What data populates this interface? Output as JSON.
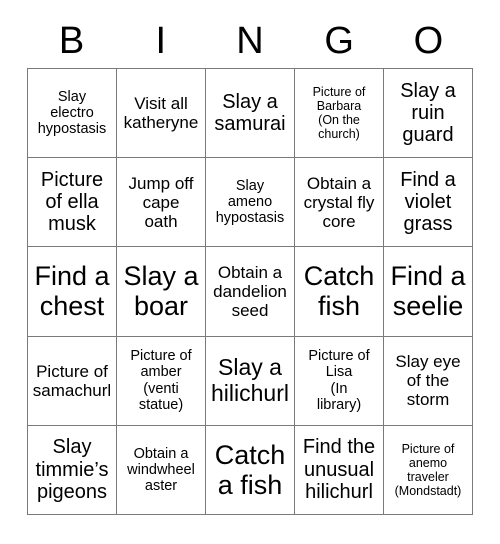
{
  "header": {
    "letters": [
      "B",
      "I",
      "N",
      "G",
      "O"
    ]
  },
  "grid": {
    "rows": 5,
    "columns": 5,
    "border_color": "#7a7a7a",
    "background_color": "#ffffff",
    "text_color": "#000000",
    "cells": [
      {
        "text": "Slay\nelectro\nhypostasis",
        "size": "s"
      },
      {
        "text": "Visit all\nkatheryne",
        "size": "m"
      },
      {
        "text": "Slay a\nsamurai",
        "size": "l"
      },
      {
        "text": "Picture of\nBarbara\n(On the\nchurch)",
        "size": "xs"
      },
      {
        "text": "Slay a\nruin\nguard",
        "size": "l"
      },
      {
        "text": "Picture\nof ella\nmusk",
        "size": "l"
      },
      {
        "text": "Jump off\ncape\noath",
        "size": "m"
      },
      {
        "text": "Slay\nameno\nhypostasis",
        "size": "s"
      },
      {
        "text": "Obtain a\ncrystal fly\ncore",
        "size": "m"
      },
      {
        "text": "Find a\nviolet\ngrass",
        "size": "l"
      },
      {
        "text": "Find a\nchest",
        "size": "xxl"
      },
      {
        "text": "Slay a\nboar",
        "size": "xxl"
      },
      {
        "text": "Obtain a\ndandelion\nseed",
        "size": "m"
      },
      {
        "text": "Catch\nfish",
        "size": "xxl"
      },
      {
        "text": "Find a\nseelie",
        "size": "xxl"
      },
      {
        "text": "Picture of\nsamachurl",
        "size": "m"
      },
      {
        "text": "Picture of\namber\n(venti\nstatue)",
        "size": "s"
      },
      {
        "text": "Slay a\nhilichurl",
        "size": "xl"
      },
      {
        "text": "Picture of\nLisa\n(In\nlibrary)",
        "size": "s"
      },
      {
        "text": "Slay eye\nof the\nstorm",
        "size": "m"
      },
      {
        "text": "Slay\ntimmie’s\npigeons",
        "size": "l"
      },
      {
        "text": "Obtain a\nwindwheel\naster",
        "size": "s"
      },
      {
        "text": "Catch\na fish",
        "size": "xxl"
      },
      {
        "text": "Find the\nunusual\nhilichurl",
        "size": "l"
      },
      {
        "text": "Picture of\nanemo\ntraveler\n(Mondstadt)",
        "size": "xs"
      }
    ]
  }
}
